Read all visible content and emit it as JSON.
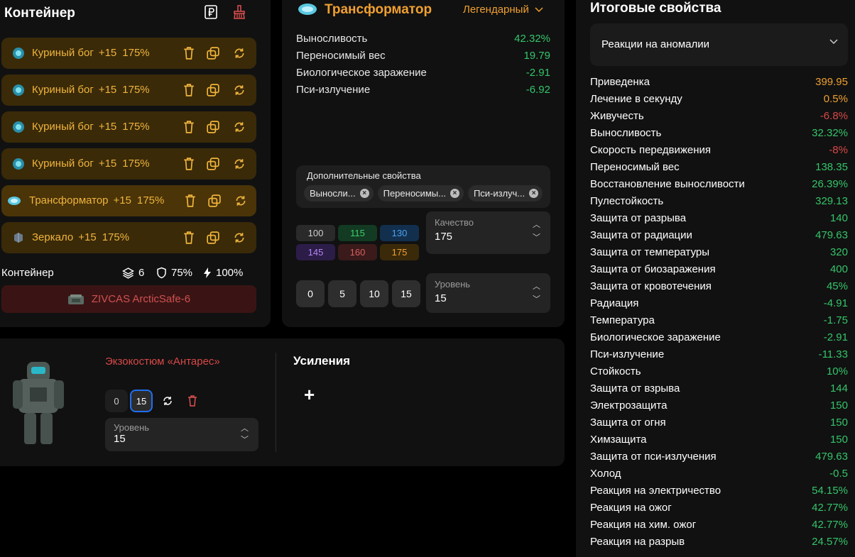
{
  "container": {
    "title": "Контейнер",
    "artifacts": [
      {
        "name": "Куриный бог",
        "boost": "+15",
        "quality": "175%",
        "icon": "chicken-god-icon"
      },
      {
        "name": "Куриный бог",
        "boost": "+15",
        "quality": "175%",
        "icon": "chicken-god-icon"
      },
      {
        "name": "Куриный бог",
        "boost": "+15",
        "quality": "175%",
        "icon": "chicken-god-icon"
      },
      {
        "name": "Куриный бог",
        "boost": "+15",
        "quality": "175%",
        "icon": "chicken-god-icon"
      },
      {
        "name": "Трансформатор",
        "boost": "+15",
        "quality": "175%",
        "icon": "transformer-icon"
      },
      {
        "name": "Зеркало",
        "boost": "+15",
        "quality": "175%",
        "icon": "mirror-icon"
      }
    ],
    "stats": {
      "label": "Контейнер",
      "slots": "6",
      "protection": "75%",
      "efficiency": "100%"
    },
    "container_name": "ZIVCAS ArcticSafe-6"
  },
  "artifact": {
    "title": "Трансформатор",
    "rarity": "Легендарный",
    "properties": [
      {
        "name": "Выносливость",
        "value": "42.32%"
      },
      {
        "name": "Переносимый вес",
        "value": "19.79"
      },
      {
        "name": "Биологическое заражение",
        "value": "-2.91"
      },
      {
        "name": "Пси-излучение",
        "value": "-6.92"
      }
    ],
    "extra_title": "Дополнительные свойства",
    "extra_chips": [
      "Выносли...",
      "Переносимы...",
      "Пси-излуч..."
    ],
    "quality_presets": [
      {
        "label": "100",
        "bg": "#2a2a2a",
        "fg": "#cfcfcf"
      },
      {
        "label": "115",
        "bg": "#133a22",
        "fg": "#3ccf6a"
      },
      {
        "label": "130",
        "bg": "#12304e",
        "fg": "#4aa0ef"
      },
      {
        "label": "145",
        "bg": "#2c1c48",
        "fg": "#b086ee"
      },
      {
        "label": "160",
        "bg": "#3a1a1a",
        "fg": "#d86060"
      },
      {
        "label": "175",
        "bg": "#3a2a0a",
        "fg": "#f0a030"
      }
    ],
    "quality_label": "Качество",
    "quality_value": "175",
    "level_presets": [
      "0",
      "5",
      "10",
      "15"
    ],
    "level_label": "Уровень",
    "level_value": "15"
  },
  "exo": {
    "name": "Экзокостюм «Антарес»",
    "level_options": [
      "0",
      "15"
    ],
    "level_label": "Уровень",
    "level_value": "15",
    "boosts_title": "Усиления",
    "add_symbol": "+"
  },
  "totals": {
    "title": "Итоговые свойства",
    "dropdown": "Реакции на аномалии",
    "rows": [
      {
        "name": "Приведенка",
        "value": "399.95",
        "color": "#f0a030"
      },
      {
        "name": "Лечение в секунду",
        "value": "0.5%",
        "color": "#f0a030"
      },
      {
        "name": "Живучесть",
        "value": "-6.8%",
        "color": "#d84848"
      },
      {
        "name": "Выносливость",
        "value": "32.32%",
        "color": "#35c46a"
      },
      {
        "name": "Скорость передвижения",
        "value": "-8%",
        "color": "#d84848"
      },
      {
        "name": "Переносимый вес",
        "value": "138.35",
        "color": "#35c46a"
      },
      {
        "name": "Восстановление выносливости",
        "value": "26.39%",
        "color": "#35c46a"
      },
      {
        "name": "Пулестойкость",
        "value": "329.13",
        "color": "#35c46a"
      },
      {
        "name": "Защита от разрыва",
        "value": "140",
        "color": "#35c46a"
      },
      {
        "name": "Защита от радиации",
        "value": "479.63",
        "color": "#35c46a"
      },
      {
        "name": "Защита от температуры",
        "value": "320",
        "color": "#35c46a"
      },
      {
        "name": "Защита от биозаражения",
        "value": "400",
        "color": "#35c46a"
      },
      {
        "name": "Защита от кровотечения",
        "value": "45%",
        "color": "#35c46a"
      },
      {
        "name": "Радиация",
        "value": "-4.91",
        "color": "#35c46a"
      },
      {
        "name": "Температура",
        "value": "-1.75",
        "color": "#35c46a"
      },
      {
        "name": "Биологическое заражение",
        "value": "-2.91",
        "color": "#35c46a"
      },
      {
        "name": "Пси-излучение",
        "value": "-11.33",
        "color": "#35c46a"
      },
      {
        "name": "Стойкость",
        "value": "10%",
        "color": "#35c46a"
      },
      {
        "name": "Защита от взрыва",
        "value": "144",
        "color": "#35c46a"
      },
      {
        "name": "Электрозащита",
        "value": "150",
        "color": "#35c46a"
      },
      {
        "name": "Защита от огня",
        "value": "150",
        "color": "#35c46a"
      },
      {
        "name": "Химзащита",
        "value": "150",
        "color": "#35c46a"
      },
      {
        "name": "Защита от пси-излучения",
        "value": "479.63",
        "color": "#35c46a"
      },
      {
        "name": "Холод",
        "value": "-0.5",
        "color": "#35c46a"
      },
      {
        "name": "Реакция на электричество",
        "value": "54.15%",
        "color": "#35c46a"
      },
      {
        "name": "Реакция на ожог",
        "value": "42.77%",
        "color": "#35c46a"
      },
      {
        "name": "Реакция на хим. ожог",
        "value": "42.77%",
        "color": "#35c46a"
      },
      {
        "name": "Реакция на разрыв",
        "value": "24.57%",
        "color": "#35c46a"
      }
    ]
  }
}
